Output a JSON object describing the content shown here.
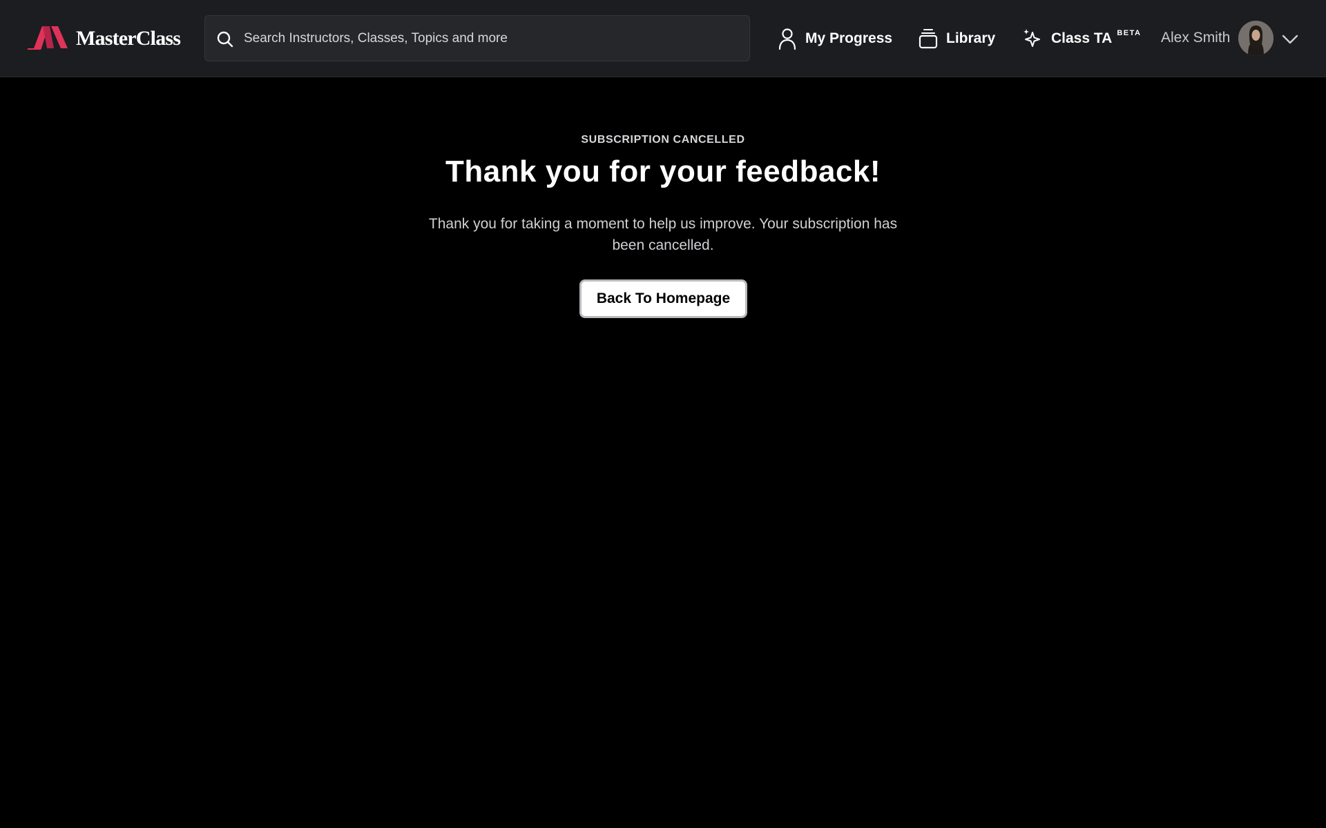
{
  "brand": {
    "name": "MasterClass",
    "accent_color": "#e0335a"
  },
  "search": {
    "placeholder": "Search Instructors, Classes, Topics and more",
    "icon": "search-icon"
  },
  "nav": {
    "my_progress": {
      "label": "My Progress",
      "icon": "person-icon"
    },
    "library": {
      "label": "Library",
      "icon": "stack-icon"
    },
    "class_ta": {
      "label": "Class TA",
      "badge": "BETA",
      "icon": "sparkle-icon"
    }
  },
  "user": {
    "name": "Alex Smith",
    "menu_icon": "chevron-down-icon"
  },
  "confirmation": {
    "eyebrow": "SUBSCRIPTION CANCELLED",
    "title": "Thank you for your feedback!",
    "message": "Thank you for taking a moment to help us improve. Your subscription has been cancelled.",
    "button_label": "Back To Homepage"
  }
}
